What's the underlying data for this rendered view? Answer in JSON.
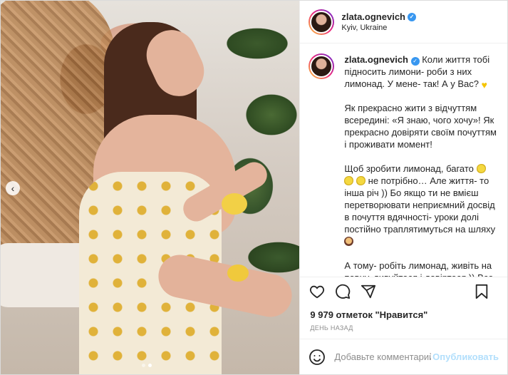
{
  "header": {
    "username": "zlata.ognevich",
    "location": "Kyiv, Ukraine"
  },
  "caption": {
    "username": "zlata.ognevich",
    "paragraphs": [
      "Коли життя тобі підносить лимони- роби з них лимонад. У мене- так! А у Вас?",
      "Як прекрасно жити з відчуттям всередині: «Я знаю, чого хочу»! Як прекрасно довіряти своїм почуттям і проживати момент!",
      "Щоб зробити лимонад, багато",
      "не потрібно… Але життя- то інша річ )) Бо якщо ти не вмієш перетворювати неприємний досвід в почуття вдячності- уроки долі постійно траплятимуться на шляху",
      "А тому- робіть лимонад, живіть на повну, дивуйтеся і довіртеся )) Все"
    ]
  },
  "likes": "9 979 отметок \"Нравится\"",
  "timestamp": "День назад",
  "comment_box": {
    "placeholder": "Добавьте комментарий...",
    "publish_label": "Опубликовать"
  },
  "icons": {
    "verified": "verified-badge-icon",
    "like": "heart-icon",
    "comment": "comment-icon",
    "share": "share-icon",
    "save": "bookmark-icon",
    "emoji": "smiley-icon",
    "prev": "chevron-left-icon"
  },
  "carousel": {
    "slides": 2,
    "active_index": 1
  },
  "colors": {
    "verified": "#3897f0",
    "publish": "#b2dffc",
    "muted": "#8e8e8e"
  }
}
